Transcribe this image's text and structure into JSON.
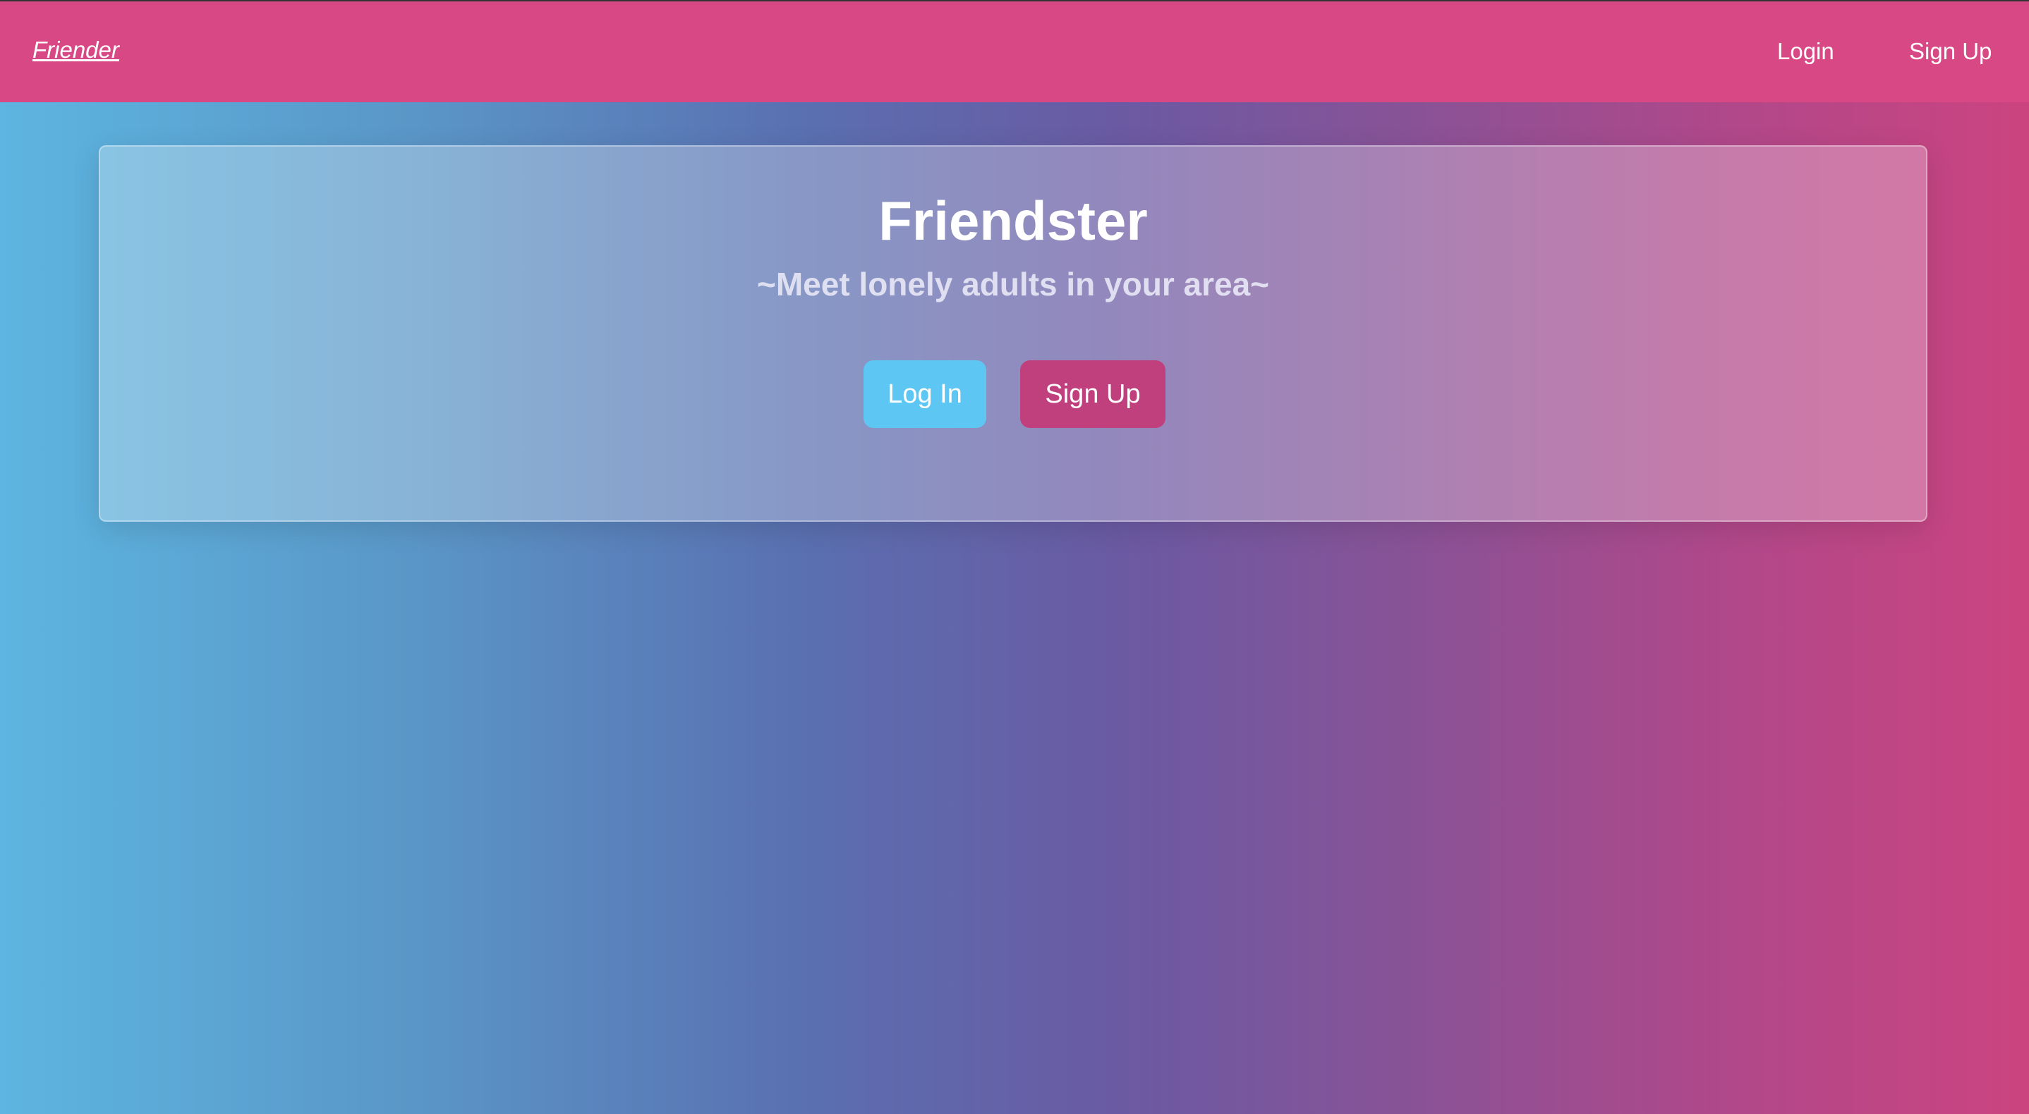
{
  "navbar": {
    "brand": "Friender",
    "links": {
      "login": "Login",
      "signup": "Sign Up"
    }
  },
  "hero": {
    "title": "Friendster",
    "subtitle": "~Meet lonely adults in your area~",
    "buttons": {
      "login": "Log In",
      "signup": "Sign Up"
    }
  },
  "colors": {
    "navbar": "#d84884",
    "login_button": "#5ec6f2",
    "signup_button": "#c0407e",
    "gradient_start": "#5db5e0",
    "gradient_end": "#cb4480"
  }
}
